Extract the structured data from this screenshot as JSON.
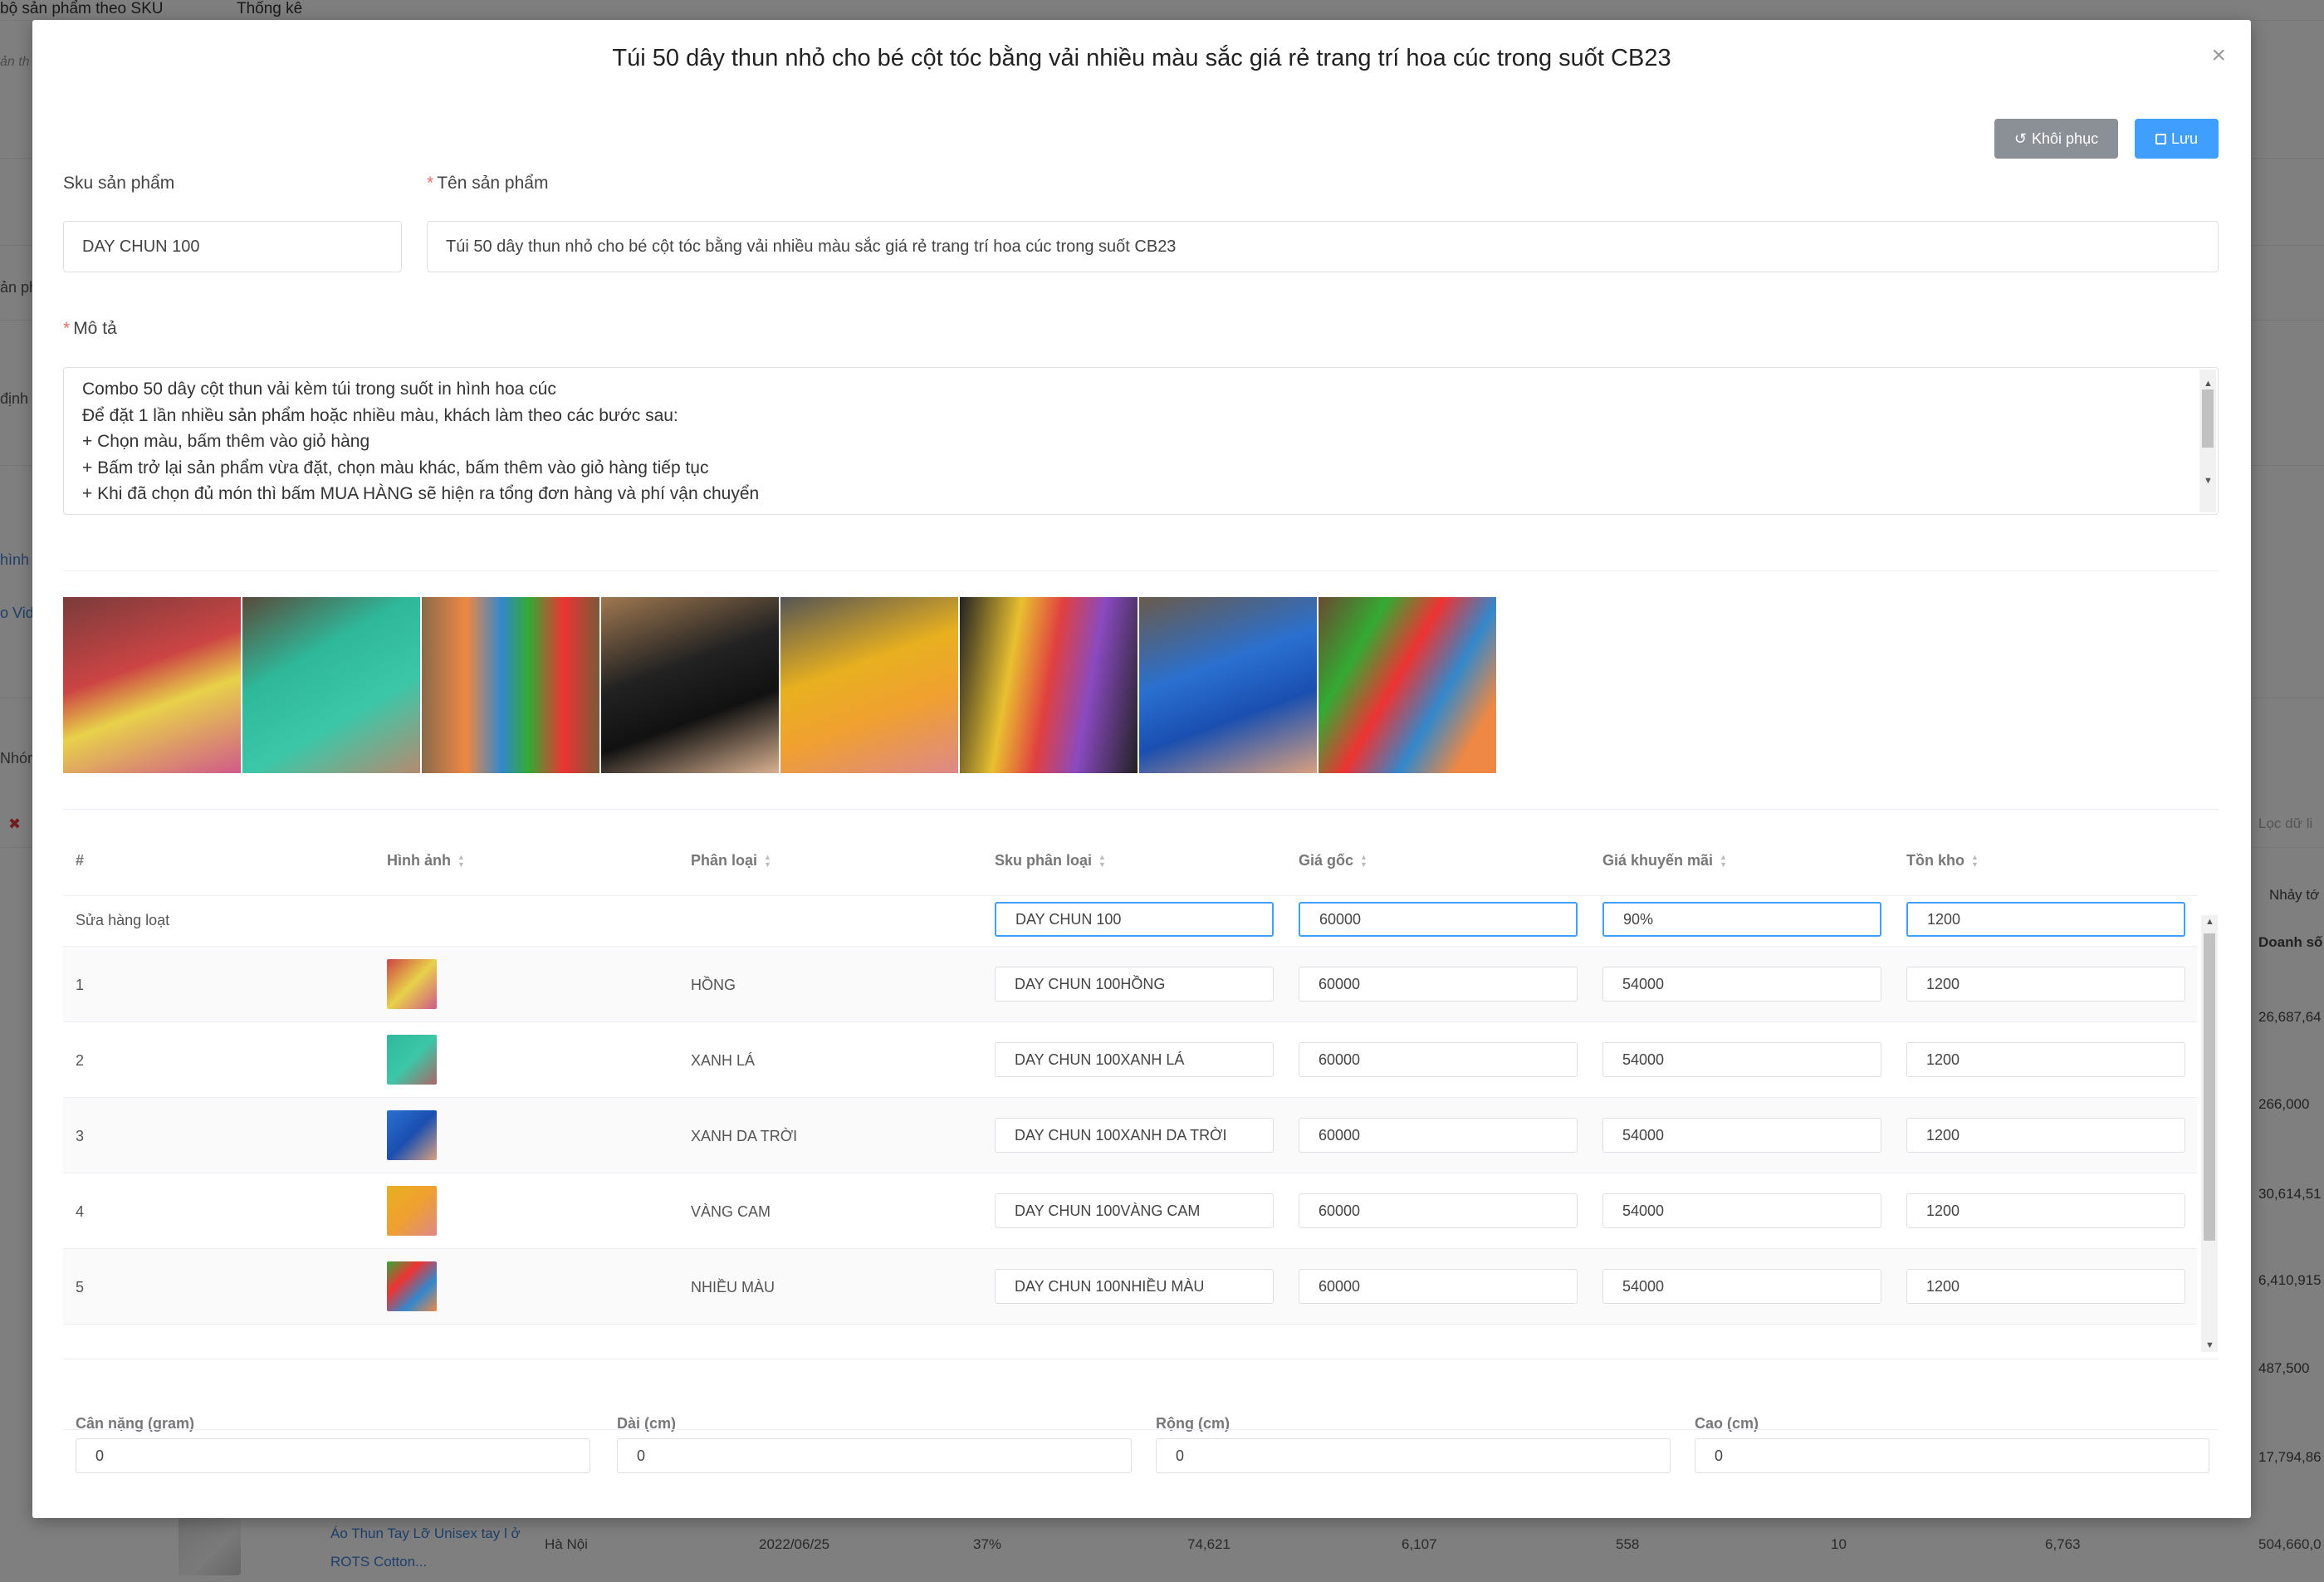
{
  "background": {
    "top_tabs": [
      "bộ sản phẩm theo SKU",
      "Thống kê"
    ],
    "side_texts": [
      "ản th",
      "ản ph",
      "định",
      "hình",
      "o Vid",
      "Nhóm"
    ],
    "filter_placeholder": "Lọc dữ li",
    "right_headers": [
      "Nhảy tớ",
      "Doanh số"
    ],
    "right_values": [
      "26,687,64",
      "266,000",
      "30,614,51",
      "6,410,915",
      "487,500",
      "17,794,86"
    ],
    "bottom_row": {
      "product_name": "Áo Thun Tay Lỡ Unisex tay l ở ROTS Cotton...",
      "location": "Hà Nội",
      "date": "2022/06/25",
      "percent": "37%",
      "v1": "74,621",
      "v2": "6,107",
      "v3": "558",
      "v4": "10",
      "v5": "6,763",
      "v6": "504,660,0"
    }
  },
  "modal": {
    "title": "Túi 50 dây thun nhỏ cho bé cột tóc bằng vải nhiều màu sắc giá rẻ trang trí hoa cúc trong suốt CB23",
    "close_icon": "×",
    "restore_label": "Khôi phục",
    "save_label": "Lưu",
    "sku_label": "Sku sản phẩm",
    "sku_value": "DAY CHUN 100",
    "name_label": "Tên sản phẩm",
    "name_value": "Túi 50 dây thun nhỏ cho bé cột tóc bằng vải nhiều màu sắc giá rẻ trang trí hoa cúc trong suốt CB23",
    "desc_label": "Mô tả",
    "desc_lines": [
      "Combo 50 dây cột thun vải kèm túi trong suốt in hình hoa cúc",
      "Để đặt 1 lần nhiều sản phẩm hoặc nhiều màu, khách làm theo các bước sau:",
      "+ Chọn màu, bấm thêm vào giỏ hàng",
      "+ Bấm trở lại sản phẩm vừa đặt, chọn màu khác, bấm thêm vào giỏ hàng tiếp tục",
      "+ Khi đã chọn đủ món thì bấm MUA HÀNG sẽ hiện ra tổng đơn hàng và phí vận chuyển"
    ]
  },
  "table": {
    "headers": [
      "#",
      "Hình ảnh",
      "Phân loại",
      "Sku phân loại",
      "Giá gốc",
      "Giá khuyến mãi",
      "Tồn kho"
    ],
    "bulk": {
      "label": "Sửa hàng loạt",
      "sku": "DAY CHUN 100",
      "price": "60000",
      "sale": "90%",
      "stock": "1200"
    },
    "rows": [
      {
        "index": "1",
        "variant": "HỒNG",
        "sku": "DAY CHUN 100HỒNG",
        "price": "60000",
        "sale": "54000",
        "stock": "1200"
      },
      {
        "index": "2",
        "variant": "XANH LÁ",
        "sku": "DAY CHUN 100XANH LÁ",
        "price": "60000",
        "sale": "54000",
        "stock": "1200"
      },
      {
        "index": "3",
        "variant": "XANH DA TRỜI",
        "sku": "DAY CHUN 100XANH DA TRỜI",
        "price": "60000",
        "sale": "54000",
        "stock": "1200"
      },
      {
        "index": "4",
        "variant": "VÀNG CAM",
        "sku": "DAY CHUN 100VÀNG CAM",
        "price": "60000",
        "sale": "54000",
        "stock": "1200"
      },
      {
        "index": "5",
        "variant": "NHIỀU MÀU",
        "sku": "DAY CHUN 100NHIỀU MÀU",
        "price": "60000",
        "sale": "54000",
        "stock": "1200"
      }
    ]
  },
  "dimensions": {
    "labels": [
      "Cân nặng (gram)",
      "Dài (cm)",
      "Rộng (cm)",
      "Cao (cm)"
    ],
    "values": [
      "0",
      "0",
      "0",
      "0"
    ]
  },
  "colors": {
    "primary": "#409eff",
    "secondary": "#8b8f96",
    "required": "#f56c6c"
  }
}
